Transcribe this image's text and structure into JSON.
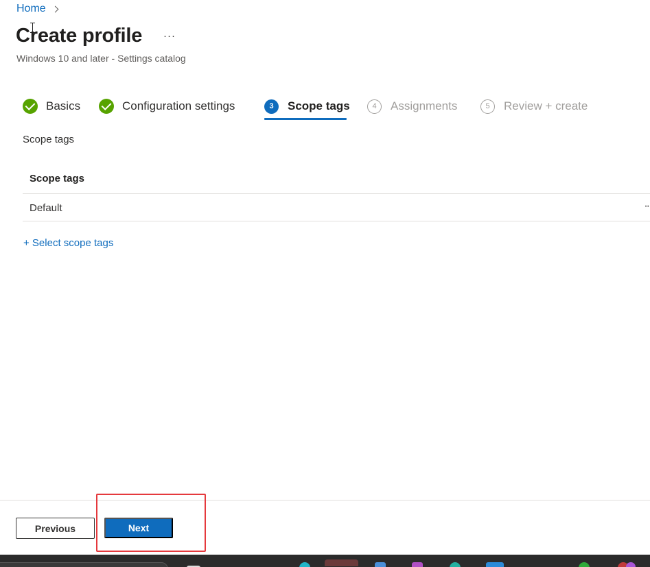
{
  "breadcrumb": {
    "home": "Home"
  },
  "header": {
    "title": "Create profile",
    "more": "···",
    "subtitle": "Windows 10 and later - Settings catalog"
  },
  "wizard": {
    "steps": [
      {
        "label": "Basics",
        "number": "1",
        "state": "done"
      },
      {
        "label": "Configuration settings",
        "number": "2",
        "state": "done"
      },
      {
        "label": "Scope tags",
        "number": "3",
        "state": "active"
      },
      {
        "label": "Assignments",
        "number": "4",
        "state": "pending"
      },
      {
        "label": "Review + create",
        "number": "5",
        "state": "pending"
      }
    ]
  },
  "main": {
    "section_label": "Scope tags",
    "table": {
      "header": "Scope tags",
      "rows": [
        {
          "value": "Default",
          "more": "··"
        }
      ]
    },
    "add_link": "+ Select scope tags"
  },
  "footer": {
    "previous_label": "Previous",
    "next_label": "Next"
  },
  "colors": {
    "accent": "#0f6cbd",
    "success": "#57a300",
    "highlight": "#e5393d"
  }
}
